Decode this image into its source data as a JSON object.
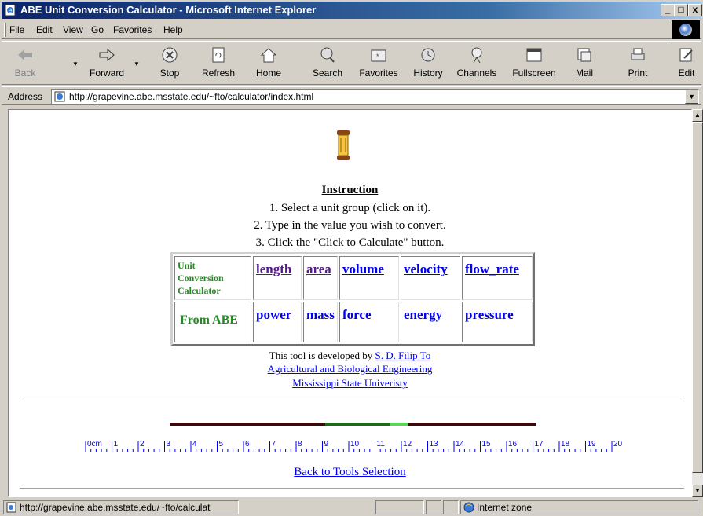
{
  "window": {
    "title": "ABE Unit Conversion Calculator - Microsoft Internet Explorer",
    "minimize": "_",
    "maximize": "□",
    "close": "x"
  },
  "menu": {
    "file": "File",
    "edit": "Edit",
    "view": "View",
    "go": "Go",
    "favorites": "Favorites",
    "help": "Help"
  },
  "toolbar": {
    "back": "Back",
    "forward": "Forward",
    "stop": "Stop",
    "refresh": "Refresh",
    "home": "Home",
    "search": "Search",
    "favorites": "Favorites",
    "history": "History",
    "channels": "Channels",
    "fullscreen": "Fullscreen",
    "mail": "Mail",
    "print": "Print",
    "edit": "Edit"
  },
  "address": {
    "label": "Address",
    "url": "http://grapevine.abe.msstate.edu/~fto/calculator/index.html"
  },
  "page": {
    "instruction_title": "Instruction",
    "step1": "1. Select a unit group (click on it).",
    "step2": "2. Type in the value you wish to convert.",
    "step3": "3. Click the \"Click to Calculate\" button.",
    "table": {
      "heading": "Unit Conversion Calculator",
      "from": "From ABE",
      "row1": [
        "length",
        "area",
        "volume",
        "velocity",
        "flow_rate"
      ],
      "row2": [
        "power",
        "mass",
        "force",
        "energy",
        "pressure"
      ]
    },
    "credit_prefix": "This tool is developed by ",
    "credit_author": "S. D. Filip To",
    "credit_dept": "Agricultural and Biological Engineering",
    "credit_univ": "Mississippi State Univeristy",
    "ruler_labels": [
      "0cm",
      "1",
      "2",
      "3",
      "4",
      "5",
      "6",
      "7",
      "8",
      "9",
      "10",
      "11",
      "12",
      "13",
      "14",
      "15",
      "16",
      "17",
      "18",
      "19",
      "20"
    ],
    "back_link": "Back to Tools Selection"
  },
  "status": {
    "url": "http://grapevine.abe.msstate.edu/~fto/calculat",
    "zone": "Internet zone"
  }
}
